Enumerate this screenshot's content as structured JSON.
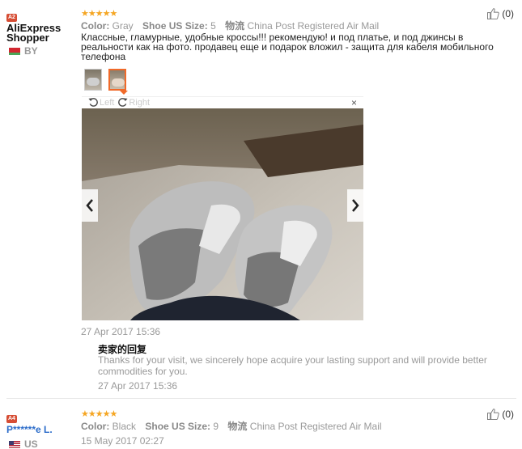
{
  "reviews": [
    {
      "level": "A2",
      "user": "AliExpress Shopper",
      "user_line1": "AliExpress",
      "user_line2": "Shopper",
      "country": "BY",
      "stars": "★★★★★",
      "rating": 5,
      "color_key": "Color:",
      "color_val": "Gray",
      "size_key": "Shoe US Size:",
      "size_val": "5",
      "ship_key": "物流",
      "ship_val": "China Post Registered Air Mail",
      "likes": "(0)",
      "feedback": "Классные, гламурные, удобные кроссы!!! рекомендую! и под платье, и под джинсы в реальности как на фото. продавец еще и подарок вложил - защита для кабеля мобильного телефона",
      "viewer": {
        "left_label": "Left",
        "right_label": "Right",
        "close": "×"
      },
      "date": "27 Apr 2017 15:36",
      "reply": {
        "title": "卖家的回复",
        "text": "Thanks for your visit, we sincerely hope acquire your lasting support and will provide better commodities for you.",
        "date": "27 Apr 2017 15:36"
      }
    },
    {
      "level": "A4",
      "user": "P******e L.",
      "country": "US",
      "stars": "★★★★★",
      "rating": 5,
      "color_key": "Color:",
      "color_val": "Black",
      "size_key": "Shoe US Size:",
      "size_val": "9",
      "ship_key": "物流",
      "ship_val": "China Post Registered Air Mail",
      "likes": "(0)",
      "date": "15 May 2017 02:27"
    }
  ],
  "colors": {
    "accent": "#f06a2a",
    "star": "#f5a623",
    "level_badge": "#d64d34",
    "masked_user": "#2a6bc9"
  },
  "icons": [
    "thumbs-up-icon",
    "rotate-left-icon",
    "rotate-right-icon",
    "close-icon",
    "chevron-left-icon",
    "chevron-right-icon"
  ]
}
